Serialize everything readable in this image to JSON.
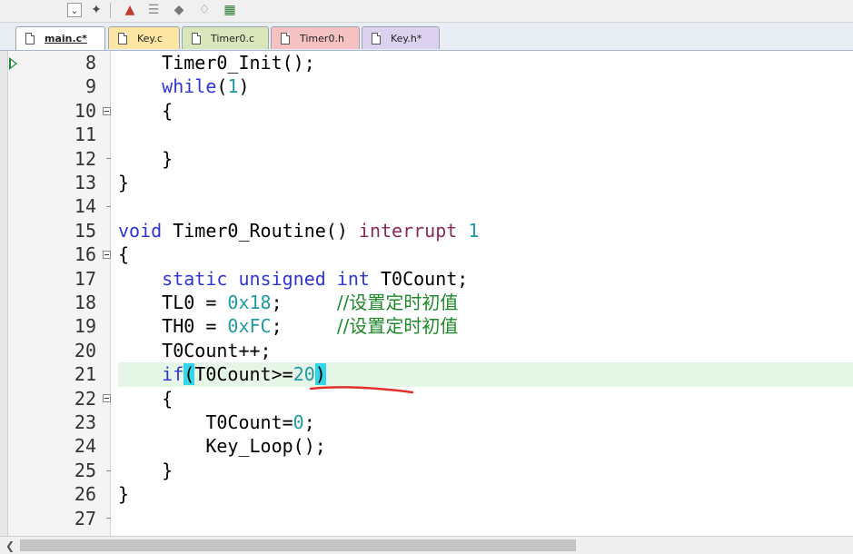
{
  "toolbar": {
    "icons": [
      "dropdown-icon",
      "wand-icon",
      "component-icon",
      "stack-icon",
      "diamond-icon",
      "gem-icon",
      "multi-project-icon"
    ]
  },
  "tabs": [
    {
      "label": "main.c*",
      "color": "#ffffff",
      "active": true
    },
    {
      "label": "Key.c",
      "color": "#fde5a3"
    },
    {
      "label": "Timer0.c",
      "color": "#d9e6bb"
    },
    {
      "label": "Timer0.h",
      "color": "#f6c1c1"
    },
    {
      "label": "Key.h*",
      "color": "#dcd2f0"
    }
  ],
  "lines": [
    {
      "no": "8",
      "code": "    Timer0_Init();"
    },
    {
      "no": "9",
      "code": "    while(1)"
    },
    {
      "no": "10",
      "code": "    {"
    },
    {
      "no": "11",
      "code": ""
    },
    {
      "no": "12",
      "code": "    }"
    },
    {
      "no": "13",
      "code": "}"
    },
    {
      "no": "14",
      "code": ""
    },
    {
      "no": "15",
      "code": "void Timer0_Routine() interrupt 1"
    },
    {
      "no": "16",
      "code": "{"
    },
    {
      "no": "17",
      "code": "    static unsigned int T0Count;"
    },
    {
      "no": "18",
      "code": "    TL0 = 0x18;     //设置定时初值"
    },
    {
      "no": "19",
      "code": "    TH0 = 0xFC;     //设置定时初值"
    },
    {
      "no": "20",
      "code": "    T0Count++;"
    },
    {
      "no": "21",
      "code": "    if(T0Count>=20)"
    },
    {
      "no": "22",
      "code": "    {"
    },
    {
      "no": "23",
      "code": "        T0Count=0;"
    },
    {
      "no": "24",
      "code": "        Key_Loop();"
    },
    {
      "no": "25",
      "code": "    }"
    },
    {
      "no": "26",
      "code": "}"
    },
    {
      "no": "27",
      "code": ""
    }
  ],
  "colors": {
    "keyword": "#2f35d6",
    "interrupt_keyword": "#8a2a5a",
    "number": "#1f9aa3",
    "comment": "#1f8a2a",
    "brace_match": "#33d6e8",
    "current_line": "#e6f6e6",
    "annotation": "#e0312a"
  }
}
